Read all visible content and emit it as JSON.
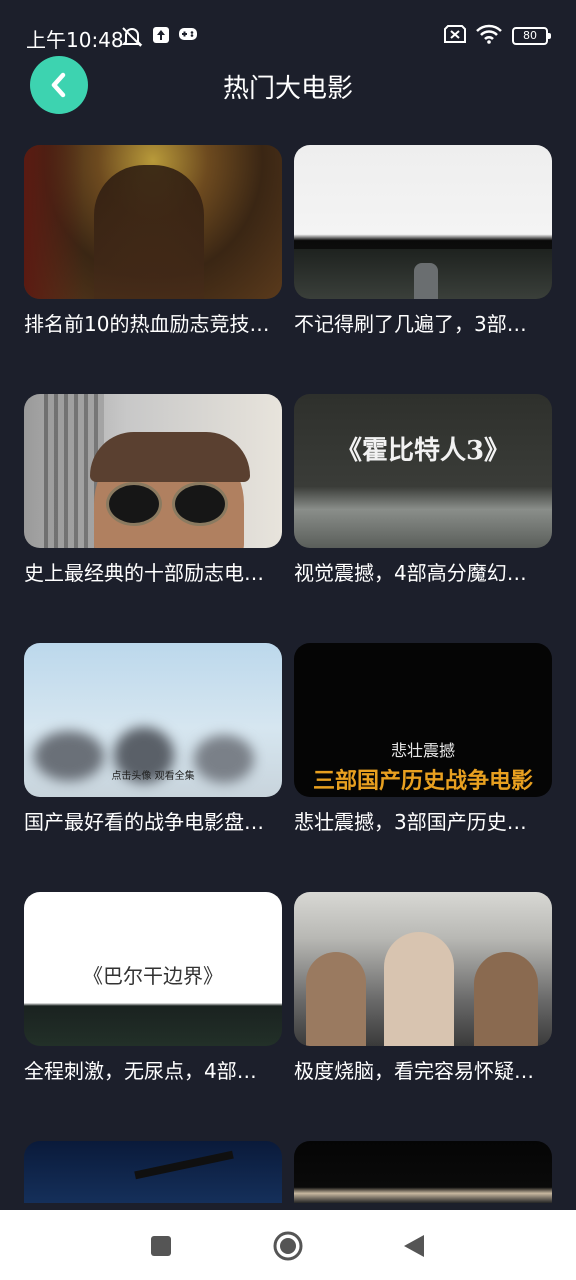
{
  "status": {
    "time": "上午10:48",
    "battery": "80",
    "icons": [
      "mute-bell-icon",
      "upload-icon",
      "gamepad-icon",
      "sim-x-icon",
      "wifi-icon",
      "battery-icon"
    ]
  },
  "header": {
    "title": "热门大电影",
    "back_icon": "chevron-left-icon",
    "accent": "#3dd3b0"
  },
  "movies": [
    {
      "title": "排名前10的热血励志竞技…",
      "overlay": ""
    },
    {
      "title": "不记得刷了几遍了，3部…",
      "overlay": ""
    },
    {
      "title": "史上最经典的十部励志电…",
      "overlay": ""
    },
    {
      "title": "视觉震撼，4部高分魔幻…",
      "overlay": "《霍比特人3》"
    },
    {
      "title": "国产最好看的战争电影盘…",
      "overlay": "点击头像 观看全集"
    },
    {
      "title": "悲壮震撼，3部国产历史…",
      "overlay": "悲壮震撼",
      "overlay2": "三部国产历史战争电影"
    },
    {
      "title": "全程刺激，无尿点，4部…",
      "overlay": "《巴尔干边界》"
    },
    {
      "title": "极度烧脑，看完容易怀疑…",
      "overlay": ""
    },
    {
      "title": "",
      "overlay": ""
    },
    {
      "title": "",
      "overlay": ""
    }
  ],
  "nav": {
    "icons": [
      "recents-square-icon",
      "home-circle-icon",
      "back-triangle-icon"
    ]
  }
}
